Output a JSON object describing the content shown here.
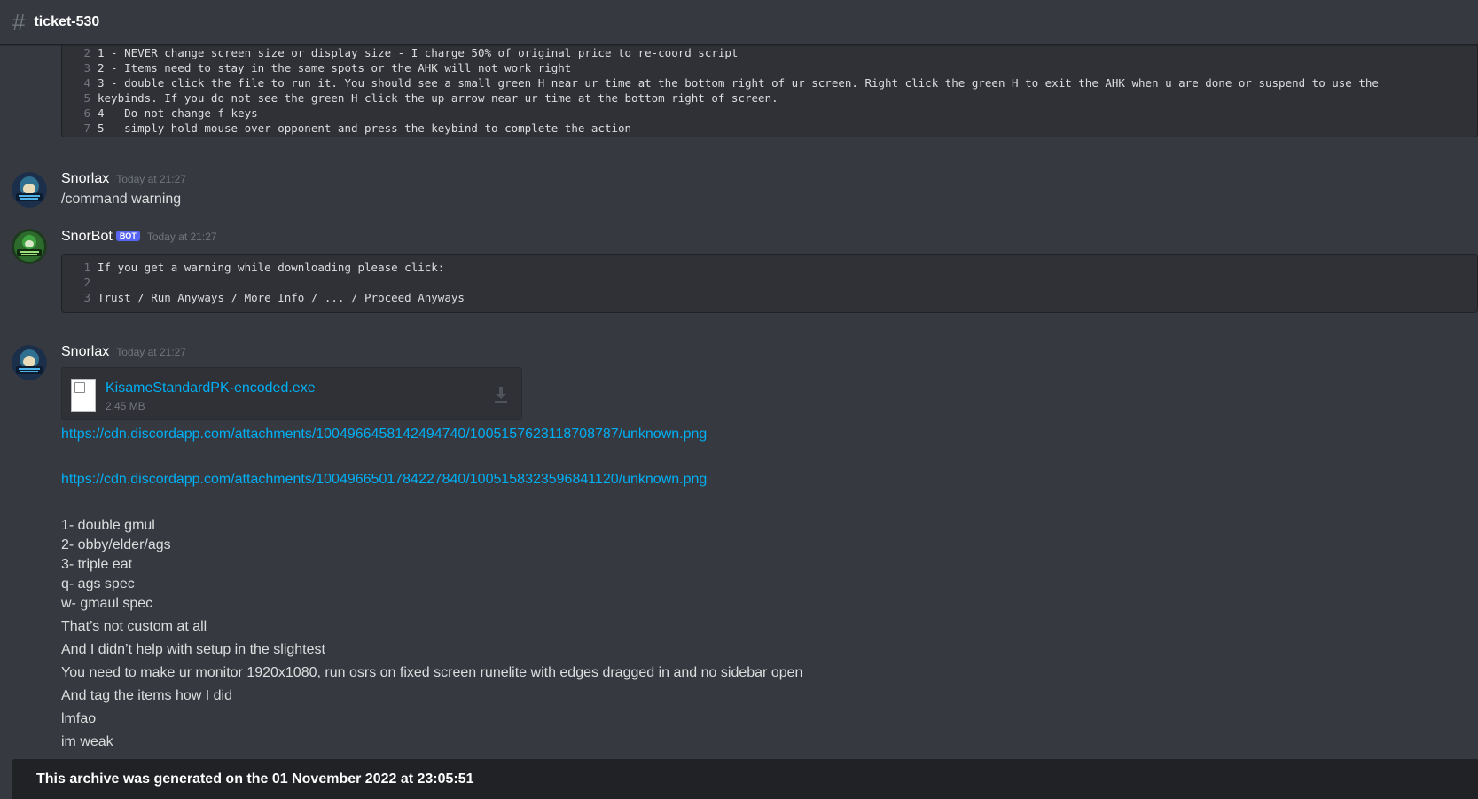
{
  "channel": {
    "hash": "#",
    "name": "ticket-530"
  },
  "top_code": {
    "lines": [
      {
        "n": "2",
        "text": "1 - NEVER change screen size or display size - I charge 50% of original price to re-coord script"
      },
      {
        "n": "3",
        "text": "2 - Items need to stay in the same spots or the AHK will not work right"
      },
      {
        "n": "4",
        "text": "3 - double click the file to run it. You should see a small green H near ur time at the bottom right of ur screen. Right click the green H to exit the AHK when u are done or suspend to use the"
      },
      {
        "n": "5",
        "text": "keybinds. If you do not see the green H click the up arrow near ur time at the bottom right of screen."
      },
      {
        "n": "6",
        "text": "4 - Do not change f keys"
      },
      {
        "n": "7",
        "text": "5 - simply hold mouse over opponent and press the keybind to complete the action"
      }
    ]
  },
  "msg1": {
    "author": "Snorlax",
    "time": "Today at 21:27",
    "text": "/command warning",
    "avatar_text": "SNORLAX SCRIPTS"
  },
  "msg2": {
    "author": "SnorBot",
    "badge": "BOT",
    "time": "Today at 21:27",
    "avatar_text": "Snorlax Skilling",
    "code": [
      {
        "n": "1",
        "text": "If you get a warning while downloading please click:"
      },
      {
        "n": "2",
        "text": ""
      },
      {
        "n": "3",
        "text": "Trust / Run Anyways / More Info / ... / Proceed Anyways"
      }
    ]
  },
  "msg3": {
    "author": "Snorlax",
    "time": "Today at 21:27",
    "attachment": {
      "name": "KisameStandardPK-encoded.exe",
      "size": "2.45 MB"
    },
    "link1": "https://cdn.discordapp.com/attachments/1004966458142494740/1005157623118708787/unknown.png",
    "link2": "https://cdn.discordapp.com/attachments/1004966501784227840/1005158323596841120/unknown.png",
    "lines": [
      "1- double gmul",
      "2- obby/elder/ags",
      "3- triple eat",
      "q- ags spec",
      "w- gmaul spec",
      "That’s not custom at all",
      "And I didn’t help with setup in the slightest",
      "You need to make ur monitor 1920x1080, run osrs on fixed screen runelite with edges dragged in and no sidebar open",
      "And tag the items how I did",
      "lmfao",
      "im weak"
    ]
  },
  "footer": {
    "text": "This archive was generated on the 01 November 2022 at 23:05:51"
  }
}
